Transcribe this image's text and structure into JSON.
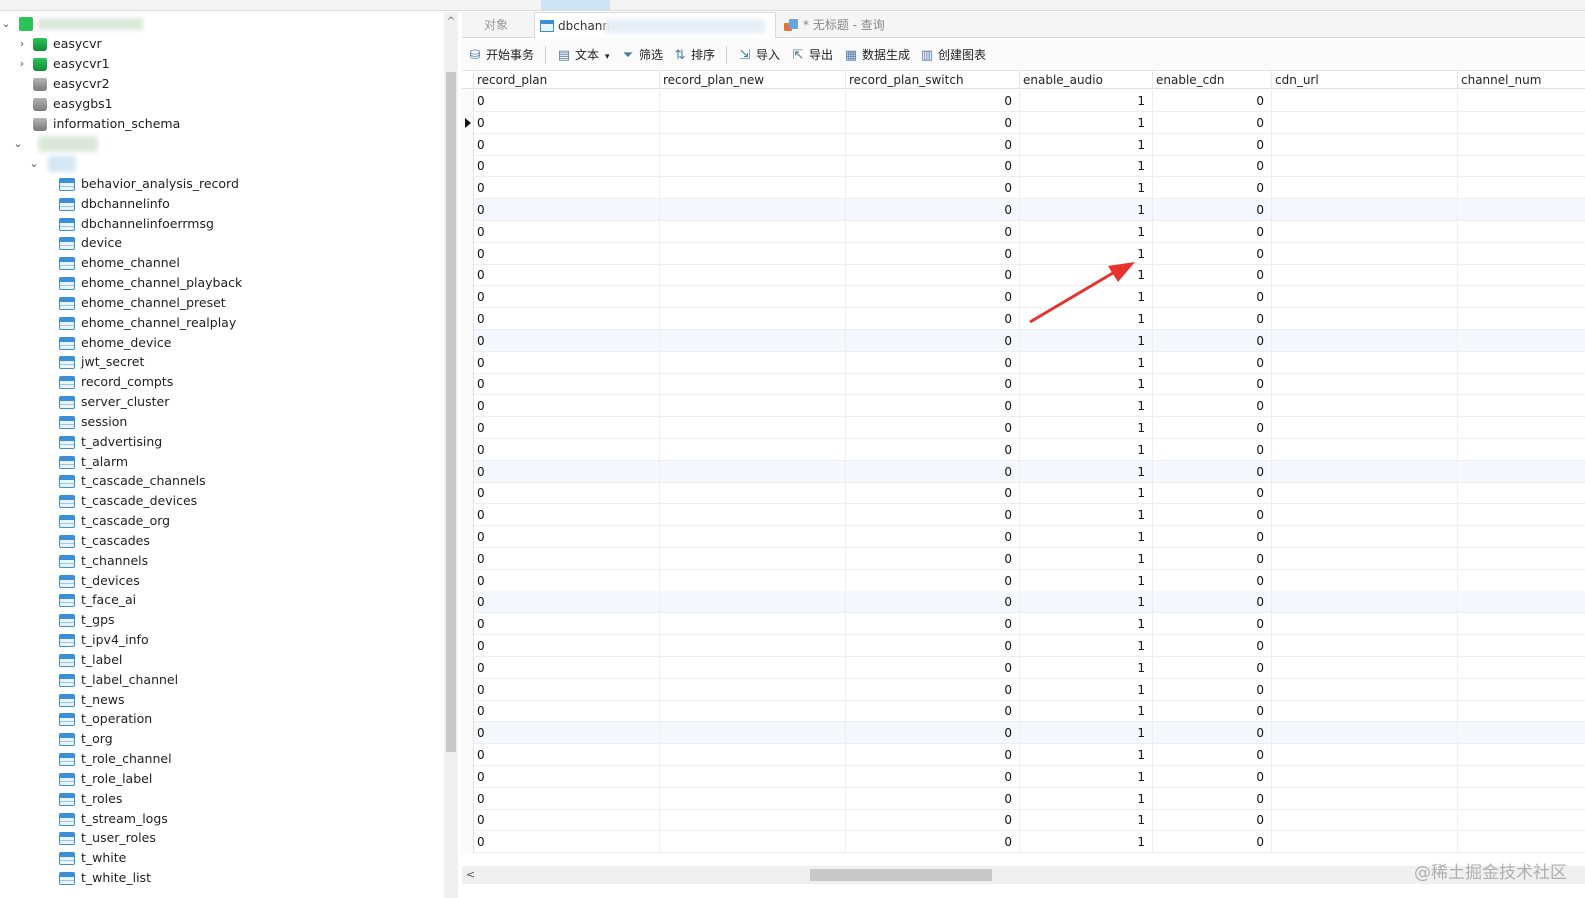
{
  "tree": {
    "databases": [
      {
        "name": "easycvr",
        "color": "green",
        "expandable": true
      },
      {
        "name": "easycvr1",
        "color": "green",
        "expandable": true
      },
      {
        "name": "easycvr2",
        "color": "gray",
        "expandable": false
      },
      {
        "name": "easygbs1",
        "color": "gray",
        "expandable": false
      },
      {
        "name": "information_schema",
        "color": "gray",
        "expandable": false
      }
    ],
    "tables": [
      "behavior_analysis_record",
      "dbchannelinfo",
      "dbchannelinfoerrmsg",
      "device",
      "ehome_channel",
      "ehome_channel_playback",
      "ehome_channel_preset",
      "ehome_channel_realplay",
      "ehome_device",
      "jwt_secret",
      "record_compts",
      "server_cluster",
      "session",
      "t_advertising",
      "t_alarm",
      "t_cascade_channels",
      "t_cascade_devices",
      "t_cascade_org",
      "t_cascades",
      "t_channels",
      "t_devices",
      "t_face_ai",
      "t_gps",
      "t_ipv4_info",
      "t_label",
      "t_label_channel",
      "t_news",
      "t_operation",
      "t_org",
      "t_role_channel",
      "t_role_label",
      "t_roles",
      "t_stream_logs",
      "t_user_roles",
      "t_white",
      "t_white_list"
    ]
  },
  "tabs": {
    "objects": "对象",
    "table_tab": "dbchann",
    "query_tab": "* 无标题 - 查询"
  },
  "toolbar": {
    "begin_transaction": "开始事务",
    "text": "文本",
    "filter": "筛选",
    "sort": "排序",
    "import": "导入",
    "export": "导出",
    "data_generation": "数据生成",
    "create_chart": "创建图表"
  },
  "grid": {
    "columns": [
      "record_plan",
      "record_plan_new",
      "record_plan_switch",
      "enable_audio",
      "enable_cdn",
      "cdn_url",
      "channel_num"
    ],
    "row_count": 35,
    "current_row": 1,
    "row_values": {
      "record_plan": "0",
      "record_plan_new": "",
      "record_plan_switch": "0",
      "enable_audio": "1",
      "enable_cdn": "0",
      "cdn_url": "",
      "channel_num": ""
    }
  },
  "annotation": {
    "arrow_color": "#e8322d",
    "target_column": "enable_audio"
  },
  "watermark": "@稀土掘金技术社区"
}
